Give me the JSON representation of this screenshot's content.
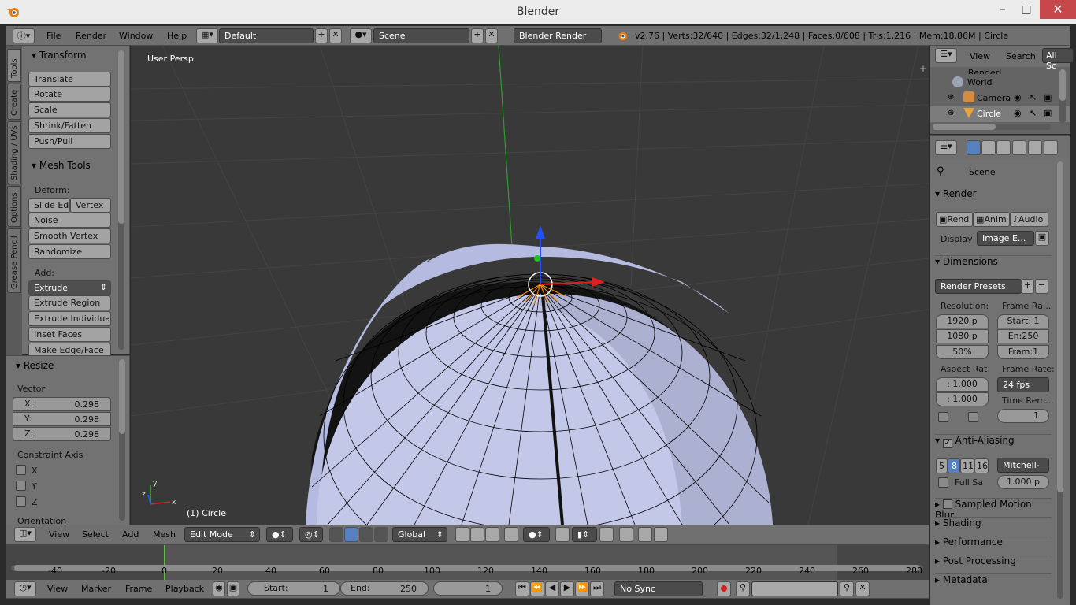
{
  "window": {
    "title": "Blender"
  },
  "menubar": {
    "items": [
      "File",
      "Render",
      "Window",
      "Help"
    ],
    "layout": "Default",
    "scene": "Scene",
    "engine": "Blender Render",
    "info": "v2.76 | Verts:32/640 | Edges:32/1,248 | Faces:0/608 | Tris:1,216 | Mem:18.86M | Circle"
  },
  "tabs": [
    "Tools",
    "Create",
    "Shading / UVs",
    "Options",
    "Grease Pencil"
  ],
  "toolshelf": {
    "transform": {
      "title": "Transform",
      "buttons": [
        "Translate",
        "Rotate",
        "Scale",
        "Shrink/Fatten",
        "Push/Pull"
      ]
    },
    "mesh_tools": {
      "title": "Mesh Tools",
      "deform_label": "Deform:",
      "slide_edge": "Slide Ed",
      "vertex": "Vertex",
      "buttons": [
        "Noise",
        "Smooth Vertex",
        "Randomize"
      ],
      "add_label": "Add:",
      "extrude": "Extrude",
      "add_buttons": [
        "Extrude Region",
        "Extrude Individual",
        "Inset Faces",
        "Make Edge/Face"
      ]
    }
  },
  "resize": {
    "title": "Resize",
    "vector_label": "Vector",
    "x_label": "X:",
    "x": "0.298",
    "y_label": "Y:",
    "y": "0.298",
    "z_label": "Z:",
    "z": "0.298",
    "constraint_label": "Constraint Axis",
    "axes": [
      "X",
      "Y",
      "Z"
    ],
    "orientation_label": "Orientation"
  },
  "viewport": {
    "view_label": "User Persp",
    "object_label": "(1) Circle",
    "axis_y": "y",
    "axis_x": "x",
    "axis_z": "z"
  },
  "viewport_header": {
    "menus": [
      "View",
      "Select",
      "Add",
      "Mesh"
    ],
    "mode": "Edit Mode",
    "orientation": "Global"
  },
  "outliner": {
    "menus": [
      "View",
      "Search"
    ],
    "all_scenes": "All Sc",
    "items": [
      {
        "name": "RenderL"
      },
      {
        "name": "World"
      },
      {
        "name": "Camera"
      },
      {
        "name": "Circle"
      }
    ]
  },
  "properties": {
    "scene": "Scene",
    "render_title": "Render",
    "render_btn": "Rend",
    "anim_btn": "Anim",
    "audio_btn": "Audio",
    "display_label": "Display",
    "display_value": "Image E...",
    "dimensions_title": "Dimensions",
    "presets": "Render Presets",
    "resolution_label": "Resolution:",
    "res_x": "1920 p",
    "res_y": "1080 p",
    "res_pct": "50%",
    "frame_range_label": "Frame Ra...",
    "start": "Start: 1",
    "end": "En:250",
    "frame": "Fram:1",
    "aspect_label": "Aspect Rat",
    "aspect_x": ": 1.000",
    "aspect_y": ": 1.000",
    "frame_rate_label": "Frame Rate:",
    "fps": "24 fps",
    "time_remap_label": "Time Rem...",
    "time_remap_value": "1",
    "aa_title": "Anti-Aliasing",
    "aa_samples": [
      "5",
      "8",
      "11",
      "16"
    ],
    "aa_filter": "Mitchell-",
    "full_sample": "Full Sa",
    "filter_size": "1.000 p",
    "sections": [
      "Sampled Motion Blur",
      "Shading",
      "Performance",
      "Post Processing",
      "Metadata"
    ]
  },
  "timeline": {
    "ticks": [
      "-40",
      "-20",
      "0",
      "20",
      "40",
      "60",
      "80",
      "100",
      "120",
      "140",
      "160",
      "180",
      "200",
      "220",
      "240",
      "260",
      "280"
    ],
    "menus": [
      "View",
      "Marker",
      "Frame",
      "Playback"
    ],
    "start_label": "Start:",
    "start": "1",
    "end_label": "End:",
    "end": "250",
    "current": "1",
    "sync": "No Sync"
  },
  "colors": {
    "accent": "#5680c2",
    "selected_edges": "#ff8a00",
    "x_axis": "#e02020",
    "y_axis": "#20c020",
    "z_axis": "#2050ff"
  }
}
